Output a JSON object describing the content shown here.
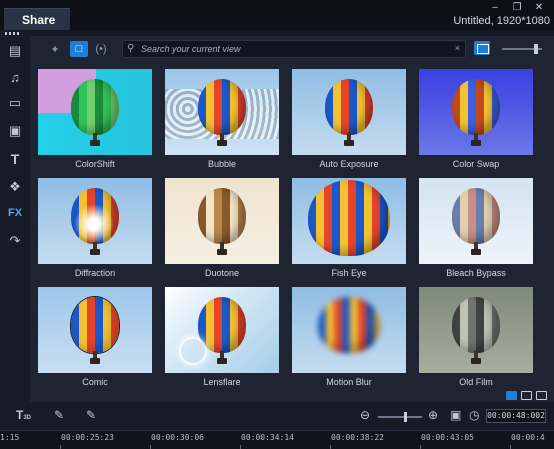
{
  "window": {
    "active_tab": "Share",
    "project_info": "Untitled, 1920*1080",
    "controls": [
      "minimize",
      "restore",
      "close"
    ]
  },
  "left_nav": [
    {
      "name": "media-icon"
    },
    {
      "name": "instant-project-icon"
    },
    {
      "name": "transition-icon"
    },
    {
      "name": "title-icon"
    },
    {
      "name": "text-icon"
    },
    {
      "name": "graphic-icon"
    },
    {
      "name": "filter-icon",
      "label": "FX",
      "active": true
    },
    {
      "name": "path-icon"
    }
  ],
  "library": {
    "search_placeholder": "Search your current view",
    "items": [
      {
        "label": "ColorShift"
      },
      {
        "label": "Bubble"
      },
      {
        "label": "Auto Exposure"
      },
      {
        "label": "Color Swap"
      },
      {
        "label": "Diffraction"
      },
      {
        "label": "Duotone"
      },
      {
        "label": "Fish Eye"
      },
      {
        "label": "Bleach Bypass"
      },
      {
        "label": "Comic"
      },
      {
        "label": "Lensflare"
      },
      {
        "label": "Motion Blur"
      },
      {
        "label": "Old Film"
      }
    ]
  },
  "timeline": {
    "timecode": "00:00:48:002",
    "ruler": [
      "1:15",
      "00:00:25:23",
      "00:00:30:06",
      "00:00:34:14",
      "00:00:38:22",
      "00:00:43:05",
      "00:00:4"
    ]
  },
  "colors": {
    "accent": "#1f7fd8",
    "active_nav": "#4aa9ff",
    "panel_bg": "#1e2431"
  }
}
